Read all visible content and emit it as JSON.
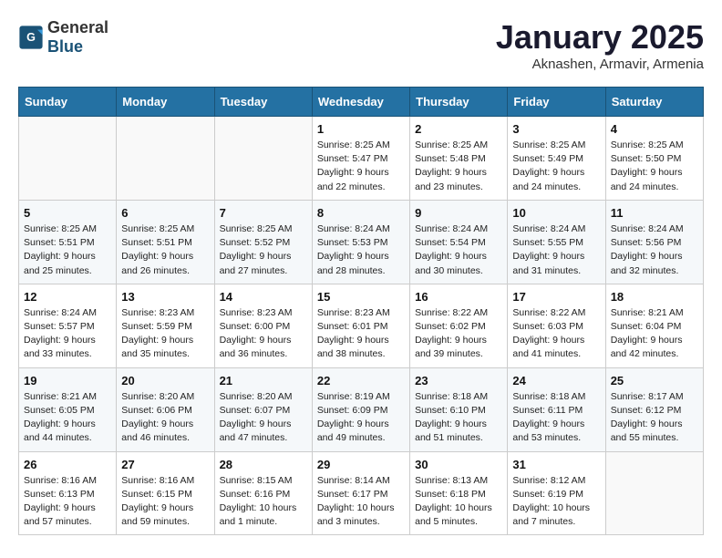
{
  "header": {
    "logo_general": "General",
    "logo_blue": "Blue",
    "title": "January 2025",
    "subtitle": "Aknashen, Armavir, Armenia"
  },
  "weekdays": [
    "Sunday",
    "Monday",
    "Tuesday",
    "Wednesday",
    "Thursday",
    "Friday",
    "Saturday"
  ],
  "weeks": [
    [
      {
        "day": "",
        "info": ""
      },
      {
        "day": "",
        "info": ""
      },
      {
        "day": "",
        "info": ""
      },
      {
        "day": "1",
        "info": "Sunrise: 8:25 AM\nSunset: 5:47 PM\nDaylight: 9 hours\nand 22 minutes."
      },
      {
        "day": "2",
        "info": "Sunrise: 8:25 AM\nSunset: 5:48 PM\nDaylight: 9 hours\nand 23 minutes."
      },
      {
        "day": "3",
        "info": "Sunrise: 8:25 AM\nSunset: 5:49 PM\nDaylight: 9 hours\nand 24 minutes."
      },
      {
        "day": "4",
        "info": "Sunrise: 8:25 AM\nSunset: 5:50 PM\nDaylight: 9 hours\nand 24 minutes."
      }
    ],
    [
      {
        "day": "5",
        "info": "Sunrise: 8:25 AM\nSunset: 5:51 PM\nDaylight: 9 hours\nand 25 minutes."
      },
      {
        "day": "6",
        "info": "Sunrise: 8:25 AM\nSunset: 5:51 PM\nDaylight: 9 hours\nand 26 minutes."
      },
      {
        "day": "7",
        "info": "Sunrise: 8:25 AM\nSunset: 5:52 PM\nDaylight: 9 hours\nand 27 minutes."
      },
      {
        "day": "8",
        "info": "Sunrise: 8:24 AM\nSunset: 5:53 PM\nDaylight: 9 hours\nand 28 minutes."
      },
      {
        "day": "9",
        "info": "Sunrise: 8:24 AM\nSunset: 5:54 PM\nDaylight: 9 hours\nand 30 minutes."
      },
      {
        "day": "10",
        "info": "Sunrise: 8:24 AM\nSunset: 5:55 PM\nDaylight: 9 hours\nand 31 minutes."
      },
      {
        "day": "11",
        "info": "Sunrise: 8:24 AM\nSunset: 5:56 PM\nDaylight: 9 hours\nand 32 minutes."
      }
    ],
    [
      {
        "day": "12",
        "info": "Sunrise: 8:24 AM\nSunset: 5:57 PM\nDaylight: 9 hours\nand 33 minutes."
      },
      {
        "day": "13",
        "info": "Sunrise: 8:23 AM\nSunset: 5:59 PM\nDaylight: 9 hours\nand 35 minutes."
      },
      {
        "day": "14",
        "info": "Sunrise: 8:23 AM\nSunset: 6:00 PM\nDaylight: 9 hours\nand 36 minutes."
      },
      {
        "day": "15",
        "info": "Sunrise: 8:23 AM\nSunset: 6:01 PM\nDaylight: 9 hours\nand 38 minutes."
      },
      {
        "day": "16",
        "info": "Sunrise: 8:22 AM\nSunset: 6:02 PM\nDaylight: 9 hours\nand 39 minutes."
      },
      {
        "day": "17",
        "info": "Sunrise: 8:22 AM\nSunset: 6:03 PM\nDaylight: 9 hours\nand 41 minutes."
      },
      {
        "day": "18",
        "info": "Sunrise: 8:21 AM\nSunset: 6:04 PM\nDaylight: 9 hours\nand 42 minutes."
      }
    ],
    [
      {
        "day": "19",
        "info": "Sunrise: 8:21 AM\nSunset: 6:05 PM\nDaylight: 9 hours\nand 44 minutes."
      },
      {
        "day": "20",
        "info": "Sunrise: 8:20 AM\nSunset: 6:06 PM\nDaylight: 9 hours\nand 46 minutes."
      },
      {
        "day": "21",
        "info": "Sunrise: 8:20 AM\nSunset: 6:07 PM\nDaylight: 9 hours\nand 47 minutes."
      },
      {
        "day": "22",
        "info": "Sunrise: 8:19 AM\nSunset: 6:09 PM\nDaylight: 9 hours\nand 49 minutes."
      },
      {
        "day": "23",
        "info": "Sunrise: 8:18 AM\nSunset: 6:10 PM\nDaylight: 9 hours\nand 51 minutes."
      },
      {
        "day": "24",
        "info": "Sunrise: 8:18 AM\nSunset: 6:11 PM\nDaylight: 9 hours\nand 53 minutes."
      },
      {
        "day": "25",
        "info": "Sunrise: 8:17 AM\nSunset: 6:12 PM\nDaylight: 9 hours\nand 55 minutes."
      }
    ],
    [
      {
        "day": "26",
        "info": "Sunrise: 8:16 AM\nSunset: 6:13 PM\nDaylight: 9 hours\nand 57 minutes."
      },
      {
        "day": "27",
        "info": "Sunrise: 8:16 AM\nSunset: 6:15 PM\nDaylight: 9 hours\nand 59 minutes."
      },
      {
        "day": "28",
        "info": "Sunrise: 8:15 AM\nSunset: 6:16 PM\nDaylight: 10 hours\nand 1 minute."
      },
      {
        "day": "29",
        "info": "Sunrise: 8:14 AM\nSunset: 6:17 PM\nDaylight: 10 hours\nand 3 minutes."
      },
      {
        "day": "30",
        "info": "Sunrise: 8:13 AM\nSunset: 6:18 PM\nDaylight: 10 hours\nand 5 minutes."
      },
      {
        "day": "31",
        "info": "Sunrise: 8:12 AM\nSunset: 6:19 PM\nDaylight: 10 hours\nand 7 minutes."
      },
      {
        "day": "",
        "info": ""
      }
    ]
  ]
}
